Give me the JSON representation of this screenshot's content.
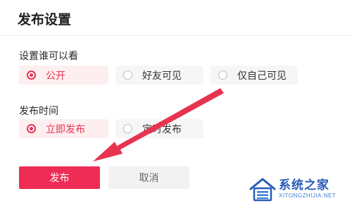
{
  "page": {
    "title": "发布设置"
  },
  "visibility": {
    "label": "设置谁可以看",
    "options": [
      "公开",
      "好友可见",
      "仅自己可见"
    ],
    "selected": "公开"
  },
  "publish_time": {
    "label": "发布时间",
    "options": [
      "立即发布",
      "定时发布"
    ],
    "selected": "立即发布"
  },
  "actions": {
    "publish_label": "发布",
    "cancel_label": "取消"
  },
  "watermark": {
    "brand": "系统之家",
    "url": "XITONGZHIJIA.NET"
  },
  "colors": {
    "accent": "#ee2c55",
    "selected_bg": "#fdeef0",
    "arrow": "#e8334f",
    "watermark": "#2a5bb9"
  }
}
